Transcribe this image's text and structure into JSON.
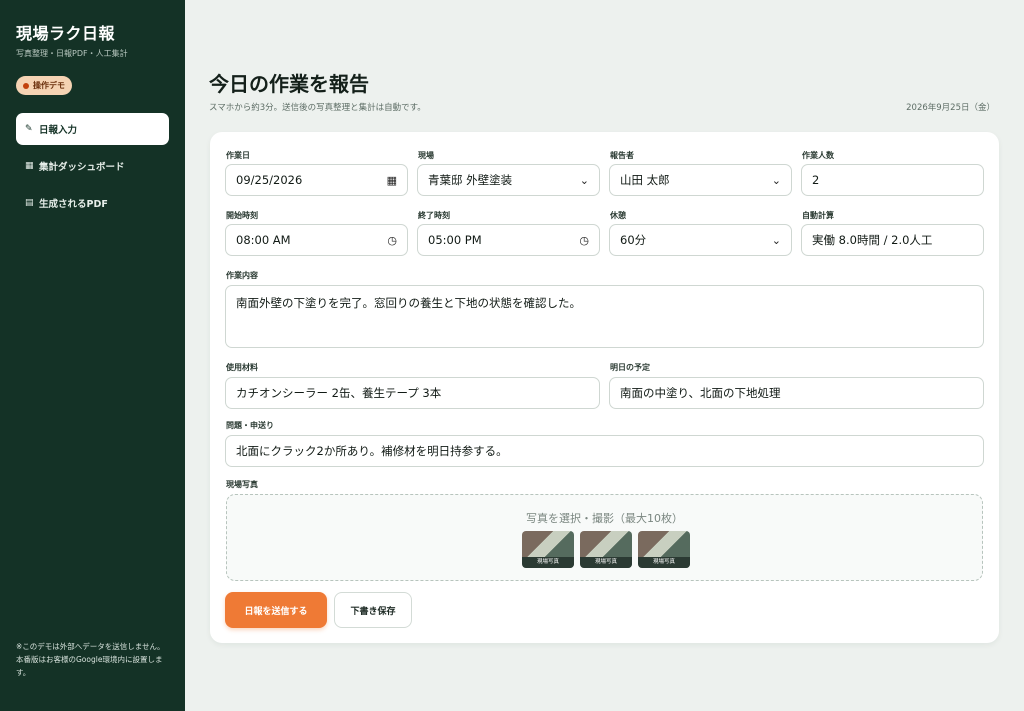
{
  "app": {
    "title": "現場ラク日報",
    "tagline": "写真整理・日報PDF・人工集計",
    "demo_badge": "操作デモ"
  },
  "sidebar": {
    "items": [
      {
        "icon": "✎",
        "label": "日報入力",
        "active": true
      },
      {
        "icon": "▦",
        "label": "集計ダッシュボード",
        "active": false
      },
      {
        "icon": "▤",
        "label": "生成されるPDF",
        "active": false
      }
    ],
    "note": "※このデモは外部へデータを送信しません。本番版はお客様のGoogle環境内に設置します。"
  },
  "header": {
    "title": "今日の作業を報告",
    "subtitle": "スマホから約3分。送信後の写真整理と集計は自動です。",
    "date": "2026年9月25日（金）"
  },
  "form": {
    "work_date": {
      "label": "作業日",
      "value": "09/25/2026"
    },
    "site": {
      "label": "現場",
      "value": "青葉邸 外壁塗装"
    },
    "reporter": {
      "label": "報告者",
      "value": "山田 太郎"
    },
    "workers": {
      "label": "作業人数",
      "value": "2"
    },
    "start_time": {
      "label": "開始時刻",
      "value": "08:00 AM"
    },
    "end_time": {
      "label": "終了時刻",
      "value": "05:00 PM"
    },
    "break": {
      "label": "休憩",
      "value": "60分"
    },
    "auto_calc": {
      "label": "自動計算",
      "value": "実働 8.0時間 / 2.0人工"
    },
    "work_content": {
      "label": "作業内容",
      "value": "南面外壁の下塗りを完了。窓回りの養生と下地の状態を確認した。"
    },
    "materials": {
      "label": "使用材料",
      "value": "カチオンシーラー 2缶、養生テープ 3本"
    },
    "tomorrow": {
      "label": "明日の予定",
      "value": "南面の中塗り、北面の下地処理"
    },
    "issues": {
      "label": "問題・申送り",
      "value": "北面にクラック2か所あり。補修材を明日持参する。"
    },
    "photos": {
      "label": "現場写真",
      "hint": "写真を選択・撮影（最大10枚）",
      "thumbs": [
        {
          "label": "現場写真"
        },
        {
          "label": "現場写真"
        },
        {
          "label": "現場写真"
        }
      ]
    }
  },
  "actions": {
    "submit": "日報を送信する",
    "draft": "下書き保存"
  },
  "colors": {
    "sidebar_bg": "#143226",
    "accent": "#ef7a35",
    "page_bg": "#edf1ee"
  }
}
